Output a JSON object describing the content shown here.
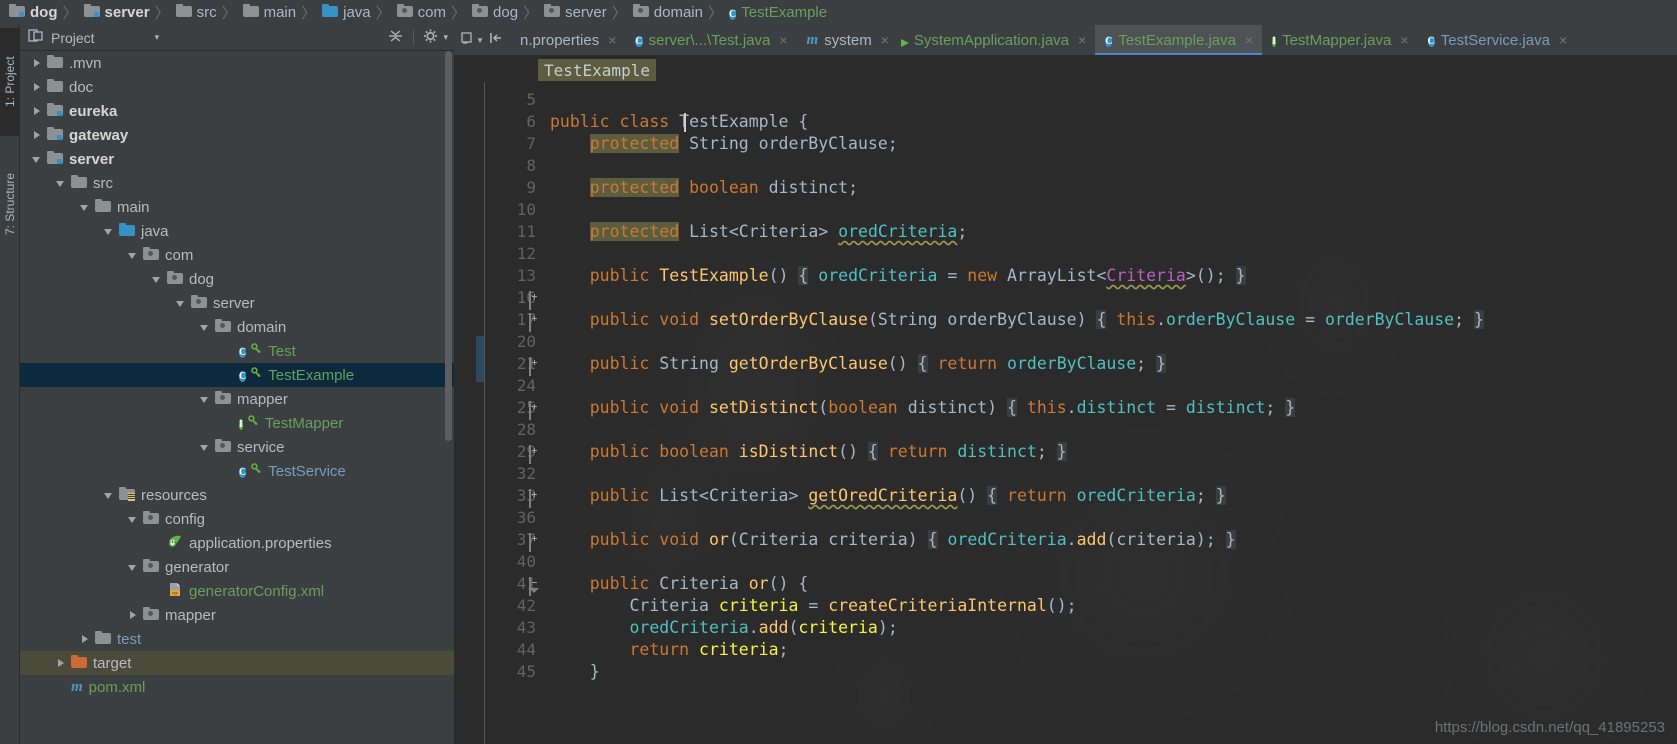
{
  "navbar": {
    "crumbs": [
      {
        "label": "dog",
        "icon": "module-folder-icon",
        "bold": true,
        "color": "white"
      },
      {
        "label": "server",
        "icon": "module-folder-icon",
        "bold": true,
        "color": "white"
      },
      {
        "label": "src",
        "icon": "folder-icon",
        "bold": false,
        "color": "default"
      },
      {
        "label": "main",
        "icon": "folder-icon",
        "bold": false,
        "color": "default"
      },
      {
        "label": "java",
        "icon": "source-folder-icon",
        "bold": false,
        "color": "default"
      },
      {
        "label": "com",
        "icon": "package-folder-icon",
        "bold": false,
        "color": "default"
      },
      {
        "label": "dog",
        "icon": "package-folder-icon",
        "bold": false,
        "color": "default"
      },
      {
        "label": "server",
        "icon": "package-folder-icon",
        "bold": false,
        "color": "default"
      },
      {
        "label": "domain",
        "icon": "package-folder-icon",
        "bold": false,
        "color": "default"
      },
      {
        "label": "TestExample",
        "icon": "class-icon",
        "bold": false,
        "color": "green"
      }
    ],
    "separator": "〉"
  },
  "tool_strip": {
    "project_tab": "1: Project",
    "structure_tab": "7: Structure"
  },
  "project_panel": {
    "title": "Project",
    "chevron": "▾",
    "collapse_all_icon": "collapse-all-icon",
    "settings_icon": "gear-icon",
    "tree": [
      {
        "label": ".mvn",
        "depth": 1,
        "arrow": "right",
        "icon": "folder-icon",
        "style": "white"
      },
      {
        "label": "doc",
        "depth": 1,
        "arrow": "right",
        "icon": "folder-icon",
        "style": "white"
      },
      {
        "label": "eureka",
        "depth": 1,
        "arrow": "right",
        "icon": "module-folder-icon",
        "style": "bold"
      },
      {
        "label": "gateway",
        "depth": 1,
        "arrow": "right",
        "icon": "module-folder-icon",
        "style": "bold"
      },
      {
        "label": "server",
        "depth": 1,
        "arrow": "down",
        "icon": "module-folder-icon",
        "style": "bold"
      },
      {
        "label": "src",
        "depth": 2,
        "arrow": "down",
        "icon": "folder-icon",
        "style": "white"
      },
      {
        "label": "main",
        "depth": 3,
        "arrow": "down",
        "icon": "folder-icon",
        "style": "white"
      },
      {
        "label": "java",
        "depth": 4,
        "arrow": "down",
        "icon": "source-folder-icon",
        "style": "white"
      },
      {
        "label": "com",
        "depth": 5,
        "arrow": "down",
        "icon": "package-folder-icon",
        "style": "white"
      },
      {
        "label": "dog",
        "depth": 6,
        "arrow": "down",
        "icon": "package-folder-icon",
        "style": "white"
      },
      {
        "label": "server",
        "depth": 7,
        "arrow": "down",
        "icon": "package-folder-icon",
        "style": "white"
      },
      {
        "label": "domain",
        "depth": 8,
        "arrow": "down",
        "icon": "package-folder-icon",
        "style": "white"
      },
      {
        "label": "Test",
        "depth": 9,
        "arrow": "none",
        "icon": "class-icon",
        "style": "green",
        "badge": "key-icon"
      },
      {
        "label": "TestExample",
        "depth": 9,
        "arrow": "none",
        "icon": "class-icon",
        "style": "green",
        "badge": "key-icon",
        "selected": true
      },
      {
        "label": "mapper",
        "depth": 8,
        "arrow": "down",
        "icon": "package-folder-icon",
        "style": "white"
      },
      {
        "label": "TestMapper",
        "depth": 9,
        "arrow": "none",
        "icon": "interface-icon",
        "style": "green",
        "badge": "key-icon"
      },
      {
        "label": "service",
        "depth": 8,
        "arrow": "down",
        "icon": "package-folder-icon",
        "style": "white"
      },
      {
        "label": "TestService",
        "depth": 9,
        "arrow": "none",
        "icon": "class-icon",
        "style": "blue",
        "badge": "key-icon"
      },
      {
        "label": "resources",
        "depth": 4,
        "arrow": "down",
        "icon": "resource-folder-icon",
        "style": "white"
      },
      {
        "label": "config",
        "depth": 5,
        "arrow": "down",
        "icon": "package-folder-icon",
        "style": "white"
      },
      {
        "label": "application.properties",
        "depth": 6,
        "arrow": "none",
        "icon": "spring-properties-icon",
        "style": "white"
      },
      {
        "label": "generator",
        "depth": 5,
        "arrow": "down",
        "icon": "package-folder-icon",
        "style": "white"
      },
      {
        "label": "generatorConfig.xml",
        "depth": 6,
        "arrow": "none",
        "icon": "xml-file-icon",
        "style": "green"
      },
      {
        "label": "mapper",
        "depth": 5,
        "arrow": "right",
        "icon": "package-folder-icon",
        "style": "white"
      },
      {
        "label": "test",
        "depth": 3,
        "arrow": "right",
        "icon": "folder-icon",
        "style": "blue"
      },
      {
        "label": "target",
        "depth": 2,
        "arrow": "right",
        "icon": "excluded-folder-icon",
        "style": "white",
        "highlighted": true
      },
      {
        "label": "pom.xml",
        "depth": 2,
        "arrow": "none",
        "icon": "maven-icon",
        "style": "green"
      }
    ]
  },
  "editor_tabs": {
    "back_icon": "tab-list-icon",
    "pin_icon": "pin-tab-icon",
    "tabs": [
      {
        "label": "n.properties",
        "icon": "none",
        "color": "default",
        "active": false,
        "close": "×",
        "truncated": true
      },
      {
        "label": "server\\...\\Test.java",
        "icon": "class-icon",
        "color": "green",
        "active": false,
        "close": "×"
      },
      {
        "label": "system",
        "icon": "maven-icon",
        "color": "default",
        "active": false,
        "close": "×"
      },
      {
        "label": "SystemApplication.java",
        "icon": "spring-class-icon",
        "color": "green",
        "active": false,
        "close": "×"
      },
      {
        "label": "TestExample.java",
        "icon": "class-icon",
        "color": "green",
        "active": true,
        "close": "×"
      },
      {
        "label": "TestMapper.java",
        "icon": "interface-icon",
        "color": "green",
        "active": false,
        "close": "×"
      },
      {
        "label": "TestService.java",
        "icon": "class-icon",
        "color": "blue",
        "active": false,
        "close": "×"
      }
    ]
  },
  "editor": {
    "breadcrumb_chip": "TestExample",
    "line_numbers": [
      5,
      6,
      7,
      8,
      9,
      10,
      11,
      12,
      13,
      16,
      17,
      20,
      21,
      24,
      25,
      28,
      29,
      32,
      33,
      36,
      37,
      40,
      41,
      42,
      43,
      44,
      45
    ],
    "fold_markers": [
      {
        "row": 9,
        "type": "plus"
      },
      {
        "row": 10,
        "type": "plus"
      },
      {
        "row": 12,
        "type": "plus"
      },
      {
        "row": 14,
        "type": "plus"
      },
      {
        "row": 16,
        "type": "plus"
      },
      {
        "row": 18,
        "type": "plus"
      },
      {
        "row": 20,
        "type": "plus"
      },
      {
        "row": 22,
        "type": "minus"
      }
    ],
    "code_lines": [
      "",
      "public class TestExample {",
      "    protected String orderByClause;",
      "",
      "    protected boolean distinct;",
      "",
      "    protected List<Criteria> oredCriteria;",
      "",
      "    public TestExample() { oredCriteria = new ArrayList<Criteria>(); }",
      "",
      "    public void setOrderByClause(String orderByClause) { this.orderByClause = orderByClause; }",
      "",
      "    public String getOrderByClause() { return orderByClause; }",
      "",
      "    public void setDistinct(boolean distinct) { this.distinct = distinct; }",
      "",
      "    public boolean isDistinct() { return distinct; }",
      "",
      "    public List<Criteria> getOredCriteria() { return oredCriteria; }",
      "",
      "    public void or(Criteria criteria) { oredCriteria.add(criteria); }",
      "",
      "    public Criteria or() {",
      "        Criteria criteria = createCriteriaInternal();",
      "        oredCriteria.add(criteria);",
      "        return criteria;",
      "    }"
    ]
  },
  "watermark": "https://blog.csdn.net/qq_41895253",
  "colors": {
    "background": "#3c3f41",
    "editor_background": "#2b2b2b",
    "accent": "#4a88c7",
    "selection": "#0d293e",
    "keyword": "#cc7832",
    "field": "#4fc1c0",
    "method": "#ffc66d",
    "local_var": "#f5f542",
    "class_green": "#6a9e5f",
    "highlight_olive": "#5c5c3f"
  }
}
